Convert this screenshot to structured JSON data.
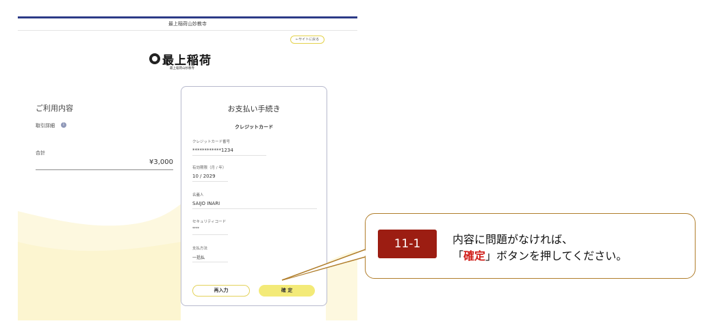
{
  "header": {
    "title": "最上稲荷山妙教寺",
    "back_link": "←サイトに戻る"
  },
  "logo": {
    "text": "最上稲荷",
    "sub": "最上稲荷山妙教寺"
  },
  "usage": {
    "heading": "ご利用内容",
    "detail_label": "取引詳細",
    "total_label": "合計",
    "total_value": "¥3,000"
  },
  "payment": {
    "title": "お支払い手続き",
    "method": "クレジットカード",
    "fields": {
      "card_number": {
        "label": "クレジットカード番号",
        "value": "************1234"
      },
      "expiry": {
        "label": "有効期限（月 / 年）",
        "value": "10 / 2029"
      },
      "holder": {
        "label": "名義人",
        "value": "SAIJO INARI"
      },
      "security": {
        "label": "セキュリティコード",
        "value": "****"
      },
      "pay_method": {
        "label": "支払方法",
        "value": "一括払"
      }
    },
    "buttons": {
      "reenter": "再入力",
      "confirm": "確 定"
    }
  },
  "callout": {
    "step": "11-1",
    "line1": "内容に問題がなければ、",
    "line2_open": "「",
    "line2_highlight": "確定",
    "line2_rest": "」ボタンを押してください。"
  },
  "colors": {
    "accent_bar": "#2b3a87",
    "confirm_button": "#f3ea78",
    "badge": "#9c1d12",
    "highlight": "#d0201b",
    "callout_border": "#b07d2a"
  }
}
